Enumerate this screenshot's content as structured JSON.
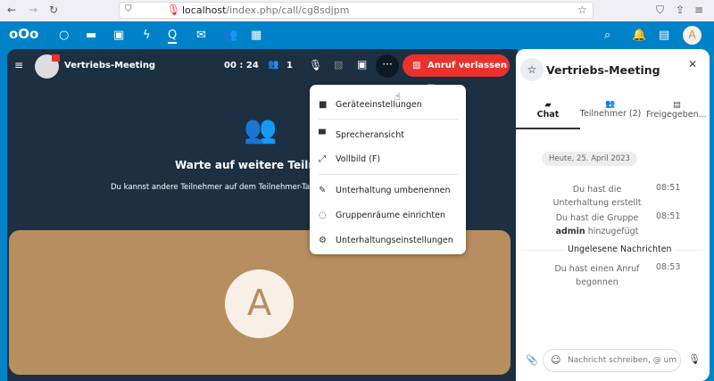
{
  "browser": {
    "url_host": "localhost",
    "url_path": "/index.php/call/cg8sdjpm"
  },
  "call": {
    "title": "Vertriebs-Meeting",
    "duration": "00 : 24",
    "participants": "1",
    "leave_label": "Anruf verlassen ▼",
    "more_label": "···"
  },
  "waiting": {
    "title": "Warte auf weitere Teilneh",
    "subtitle": "Du kannst andere Teilnehmer auf dem Teilnehmer-Ta"
  },
  "tile": {
    "avatar_letter": "A",
    "color": "#b78e5f"
  },
  "menu": {
    "items": [
      {
        "label": "Geräteeinstellungen"
      },
      {
        "label": "Sprecheransicht"
      },
      {
        "label": "Vollbild (F)"
      },
      {
        "label": "Unterhaltung umbenennen"
      },
      {
        "label": "Gruppenräume einrichten"
      },
      {
        "label": "Unterhaltungseinstellungen"
      }
    ]
  },
  "sidebar": {
    "title": "Vertriebs-Meeting",
    "tabs": [
      {
        "label": "Chat"
      },
      {
        "label": "Teilnehmer (2)"
      },
      {
        "label": "Freigegeben..."
      }
    ],
    "date": "Heute, 25. April 2023",
    "messages": [
      {
        "line1": "Du hast die",
        "line2": "Unterhaltung erstellt",
        "time": "08:51"
      },
      {
        "line1": "Du hast die Gruppe",
        "bold": "admin",
        "line2": " hinzugefügt",
        "time": "08:51"
      },
      {
        "line1": "Du hast einen Anruf",
        "line2": "begonnen",
        "time": "08:53"
      }
    ],
    "unread": "Ungelesene Nachrichten",
    "input_placeholder": "Nachricht schreiben, @ um"
  },
  "header": {
    "user_letter": "A"
  },
  "colors": {
    "brand": "#0082c9",
    "leave": "#e9322d",
    "dark": "#1c3042"
  }
}
